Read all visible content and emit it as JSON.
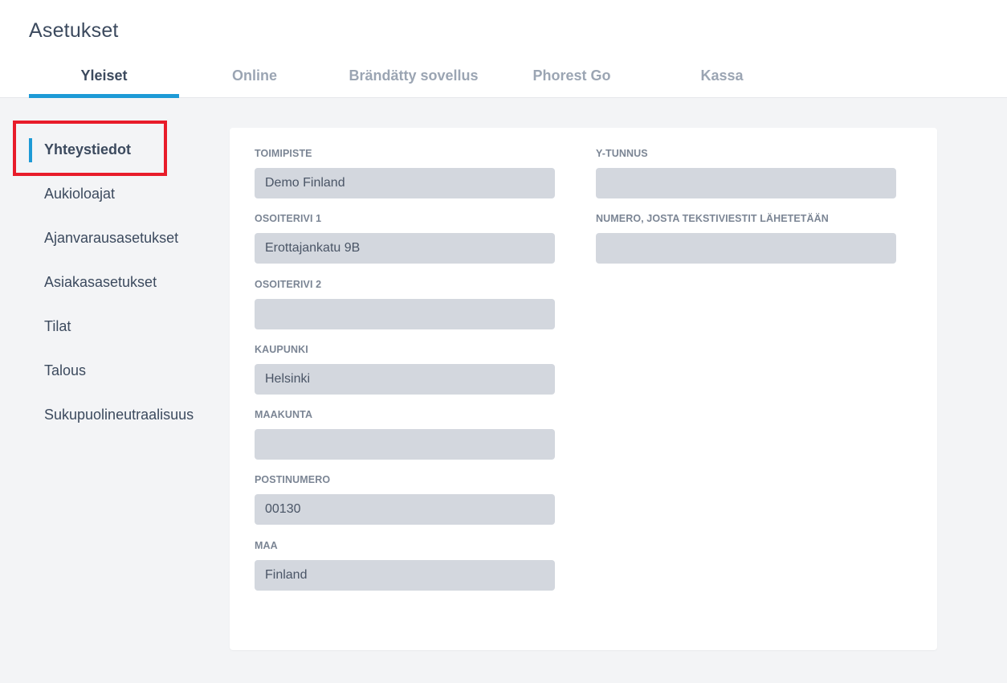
{
  "page": {
    "title": "Asetukset"
  },
  "tabs": [
    {
      "label": "Yleiset",
      "active": true
    },
    {
      "label": "Online",
      "active": false
    },
    {
      "label": "Brändätty sovellus",
      "active": false
    },
    {
      "label": "Phorest Go",
      "active": false
    },
    {
      "label": "Kassa",
      "active": false
    }
  ],
  "sidebar": {
    "items": [
      {
        "label": "Yhteystiedot",
        "active": true
      },
      {
        "label": "Aukioloajat",
        "active": false
      },
      {
        "label": "Ajanvarausasetukset",
        "active": false
      },
      {
        "label": "Asiakasasetukset",
        "active": false
      },
      {
        "label": "Tilat",
        "active": false
      },
      {
        "label": "Talous",
        "active": false
      },
      {
        "label": "Sukupuolineutraalisuus",
        "active": false
      }
    ]
  },
  "form": {
    "left": [
      {
        "label": "TOIMIPISTE",
        "value": "Demo Finland"
      },
      {
        "label": "OSOITERIVI 1",
        "value": "Erottajankatu 9B"
      },
      {
        "label": "OSOITERIVI 2",
        "value": ""
      },
      {
        "label": "KAUPUNKI",
        "value": "Helsinki"
      },
      {
        "label": "MAAKUNTA",
        "value": ""
      },
      {
        "label": "POSTINUMERO",
        "value": "00130"
      },
      {
        "label": "MAA",
        "value": "Finland"
      }
    ],
    "right": [
      {
        "label": "Y-TUNNUS",
        "value": ""
      },
      {
        "label": "NUMERO, JOSTA TEKSTIVIESTIT LÄHETETÄÄN",
        "value": ""
      }
    ]
  },
  "colors": {
    "accent": "#1d9ad6",
    "highlight": "#e81c2a",
    "text_primary": "#3c4a5e",
    "text_muted": "#9ba5b3",
    "input_bg": "#d3d7de",
    "page_bg": "#f3f4f6"
  }
}
